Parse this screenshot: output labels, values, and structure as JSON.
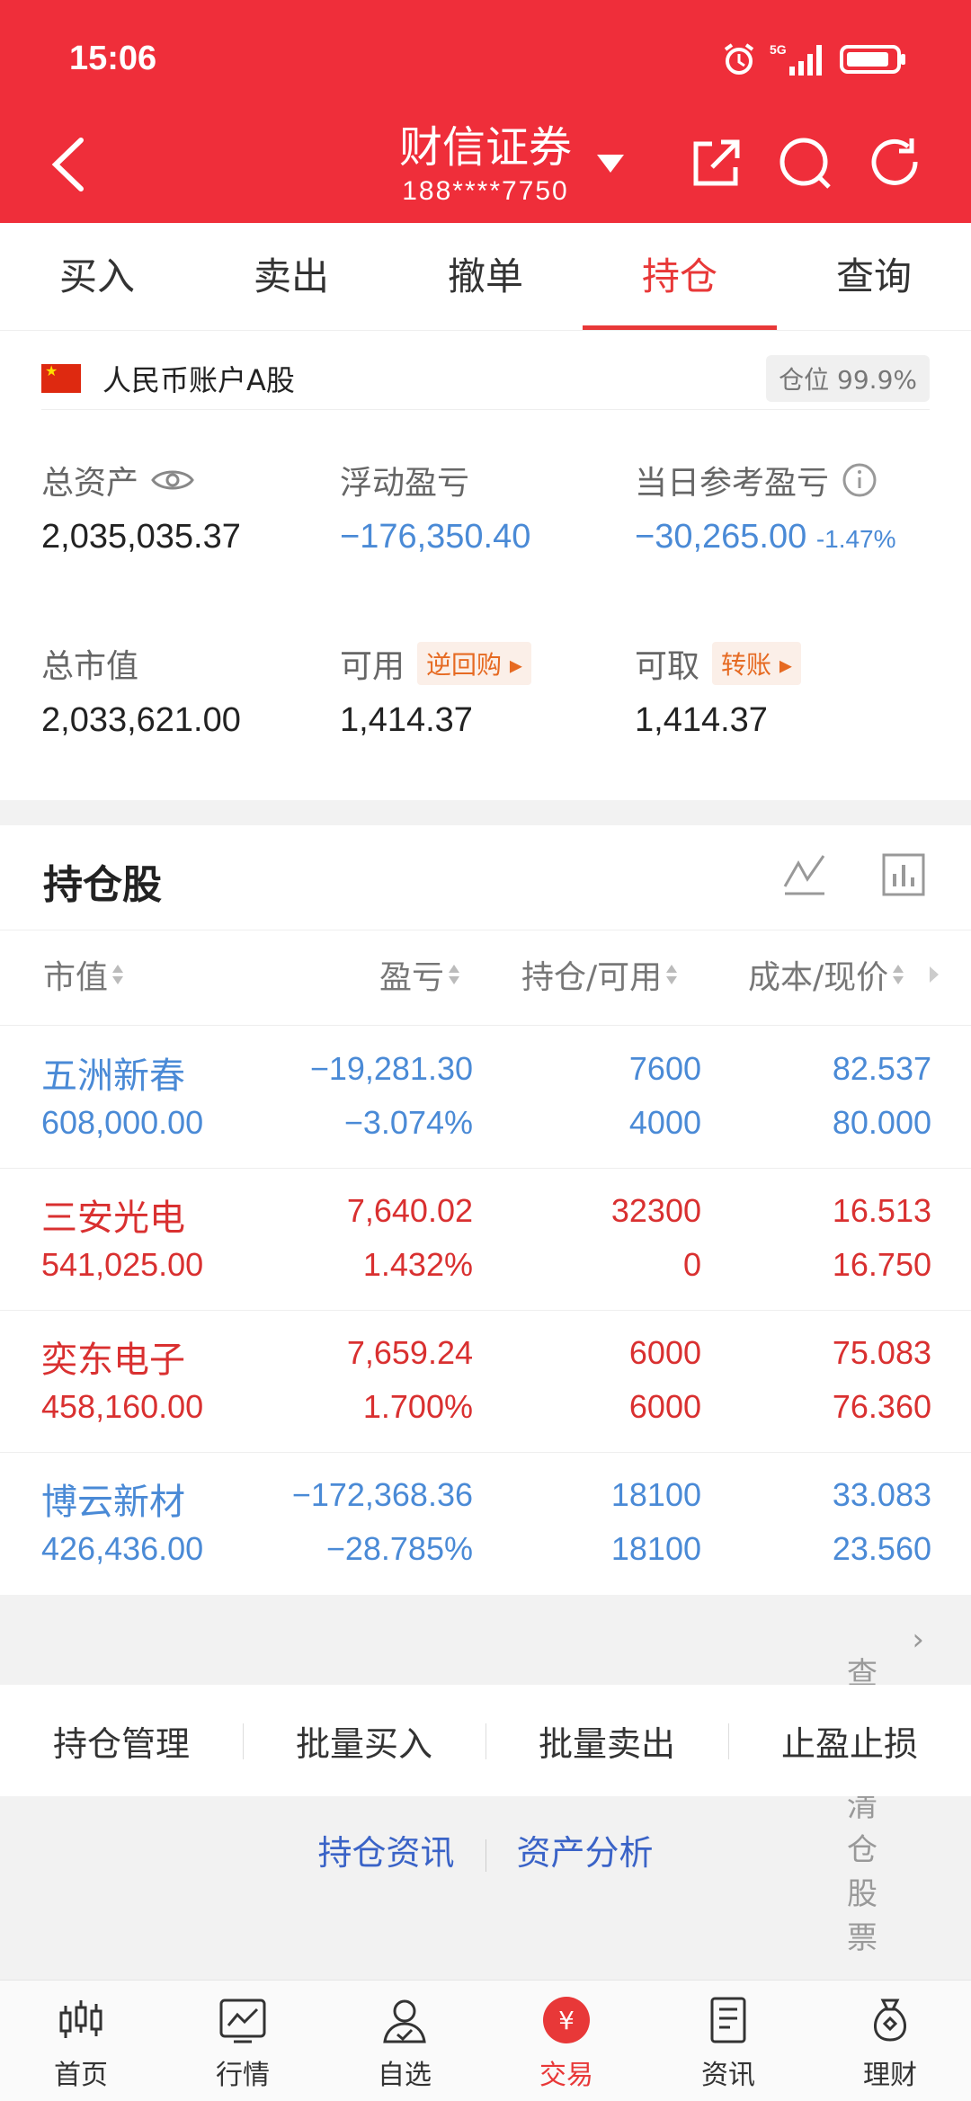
{
  "status": {
    "time": "15:06"
  },
  "nav": {
    "title": "财信证券",
    "account": "188****7750"
  },
  "tabs": [
    "买入",
    "卖出",
    "撤单",
    "持仓",
    "查询"
  ],
  "account": {
    "name": "人民币账户A股",
    "position": "仓位 99.9%"
  },
  "stats": {
    "total_assets_label": "总资产",
    "total_assets": "2,035,035.37",
    "float_pl_label": "浮动盈亏",
    "float_pl": "−176,350.40",
    "daily_pl_label": "当日参考盈亏",
    "daily_pl": "−30,265.00",
    "daily_pl_pct": "-1.47%",
    "market_value_label": "总市值",
    "market_value": "2,033,621.00",
    "available_label": "可用",
    "available_tag": "逆回购",
    "available": "1,414.37",
    "withdrawable_label": "可取",
    "withdrawable_tag": "转账",
    "withdrawable": "1,414.37"
  },
  "holdings": {
    "title": "持仓股",
    "columns": [
      "市值",
      "盈亏",
      "持仓/可用",
      "成本/现价"
    ],
    "rows": [
      {
        "name": "五洲新春",
        "value": "608,000.00",
        "pl": "−19,281.30",
        "pl_pct": "−3.074%",
        "hold": "7600",
        "avail": "4000",
        "cost": "82.537",
        "price": "80.000"
      },
      {
        "name": "三安光电",
        "value": "541,025.00",
        "pl": "7,640.02",
        "pl_pct": "1.432%",
        "hold": "32300",
        "avail": "0",
        "cost": "16.513",
        "price": "16.750"
      },
      {
        "name": "奕东电子",
        "value": "458,160.00",
        "pl": "7,659.24",
        "pl_pct": "1.700%",
        "hold": "6000",
        "avail": "6000",
        "cost": "75.083",
        "price": "76.360"
      },
      {
        "name": "博云新材",
        "value": "426,436.00",
        "pl": "−172,368.36",
        "pl_pct": "−28.785%",
        "hold": "18100",
        "avail": "18100",
        "cost": "33.083",
        "price": "23.560"
      }
    ],
    "cleared_link": "查看已清仓股票"
  },
  "actions": [
    "持仓管理",
    "批量买入",
    "批量卖出",
    "止盈止损"
  ],
  "links": [
    "持仓资讯",
    "资产分析"
  ],
  "bottom_nav": [
    "首页",
    "行情",
    "自选",
    "交易",
    "资讯",
    "理财"
  ],
  "colors": {
    "header": "#ef2e3a",
    "accent": "#e83838",
    "up": "#d93030",
    "down": "#4a8ad6"
  }
}
